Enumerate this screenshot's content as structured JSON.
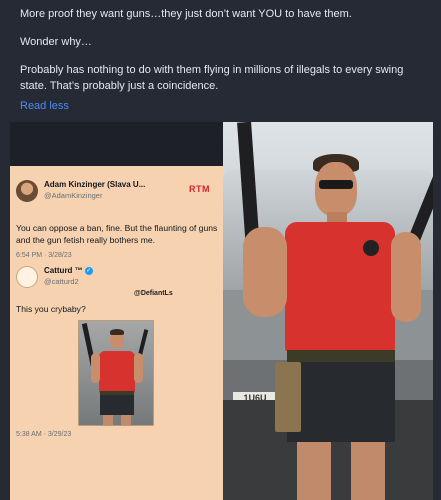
{
  "post": {
    "line1": "More proof they want guns…they just don’t want YOU to have them.",
    "line2": "Wonder why…",
    "line3": "Probably has nothing to do with them flying in millions of illegals to every swing state. That’s probably just a coincidence.",
    "read_less": "Read less"
  },
  "embedded": {
    "tweet1": {
      "name": "Adam Kinzinger (Slava U...",
      "handle": "@AdamKinzinger",
      "badge": "RTM",
      "text": "You can oppose a ban, fine.  But the flaunting of guns and the gun fetish really bothers me.",
      "meta": "6:54 PM · 3/28/23"
    },
    "tweet2": {
      "name": "Catturd ™",
      "handle": "@catturd2",
      "watermark": "@DefiantLs",
      "text": "This you crybaby?",
      "meta": "5:38 AM · 3/29/23"
    },
    "plate": "1U6U"
  },
  "colors": {
    "accent": "#4c8bf5",
    "background": "#262a35",
    "card": "#f6d2b1",
    "shirt": "#d8322f"
  }
}
